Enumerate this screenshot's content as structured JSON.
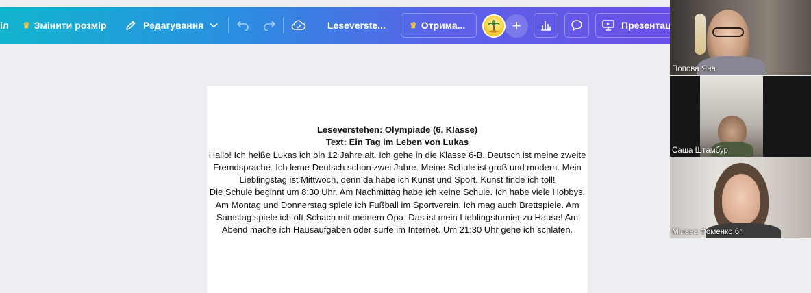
{
  "toolbar": {
    "partial_left_label": "іл",
    "resize_label": "Змінити розмір",
    "edit_label": "Редагування",
    "doc_title": "Leseverste...",
    "get_pro_label": "Отрима...",
    "present_label": "Презентац"
  },
  "document": {
    "title_line1": "Leseverstehen: Olympiade (6. Klasse)",
    "title_line2": "Text: Ein Tag im Leben von Lukas",
    "paragraph1": "Hallo! Ich heiße Lukas ich bin 12 Jahre alt. Ich gehe in die Klasse 6-B. Deutsch ist meine zweite Fremdsprache. Ich lerne Deutsch schon zwei Jahre. Meine Schule ist groß und modern. Mein Lieblingstag ist Mittwoch, denn da habe ich Kunst und Sport. Kunst finde ich toll!",
    "paragraph2": "Die Schule beginnt um 8:30 Uhr. Am Nachmittag habe ich keine Schule. Ich habe viele Hobbys. Am Montag und Donnerstag spiele ich Fußball im Sportverein. Ich mag auch Brettspiele. Am Samstag spiele ich oft Schach mit meinem Opa. Das ist mein Lieblingsturnier zu Hause! Am Abend mache ich Hausaufgaben oder surfe im Internet. Um 21:30 Uhr gehe ich schlafen."
  },
  "participants": [
    {
      "name": "Попова Яна"
    },
    {
      "name": "Саша Штамбур"
    },
    {
      "name": "Мілана Фоменко 6г"
    }
  ],
  "colors": {
    "toolbar_start": "#13b5cf",
    "toolbar_end": "#6a4fe6",
    "crown": "#f6c343"
  }
}
